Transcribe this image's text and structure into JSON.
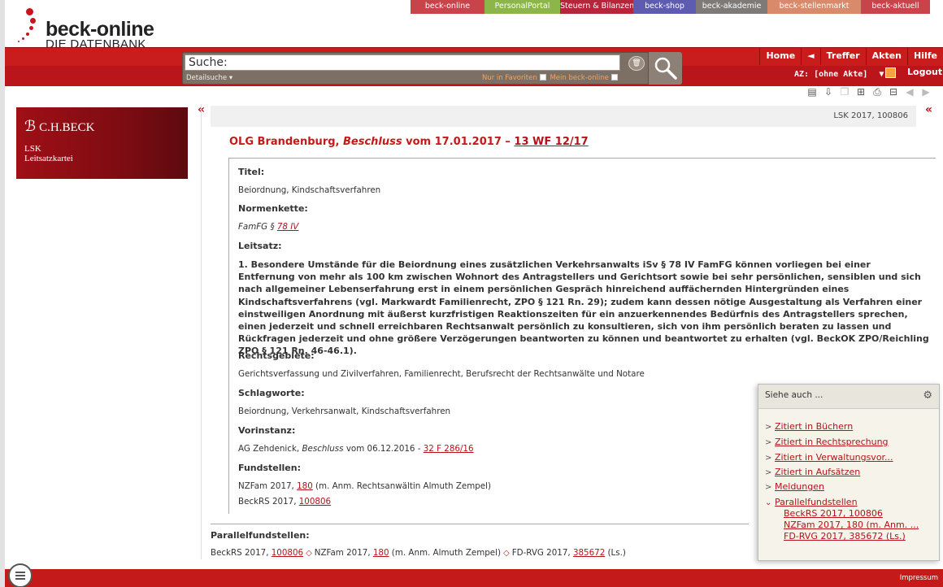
{
  "top_tabs": [
    {
      "label": "beck-online",
      "color": "#c9444a"
    },
    {
      "label": "PersonalPortal",
      "color": "#8db64a"
    },
    {
      "label": "Steuern & Bilanzen",
      "color": "#b5263a"
    },
    {
      "label": "beck-shop",
      "color": "#5e5cb0"
    },
    {
      "label": "beck-akademie",
      "color": "#7d7a78"
    },
    {
      "label": "beck-stellenmarkt",
      "color": "#d88a6a"
    },
    {
      "label": "beck-aktuell",
      "color": "#c9444a"
    }
  ],
  "logo": {
    "name": "beck-online",
    "subtitle": "DIE DATENBANK"
  },
  "search": {
    "placeholder": "Suche:",
    "detail_label": "Detailsuche ▾",
    "favorites_label": "Nur in Favoriten",
    "mybeck_label": "Mein beck-online"
  },
  "nav": {
    "home": "Home",
    "back": "◄",
    "treffer": "Treffer",
    "akten": "Akten",
    "hilfe": "Hilfe",
    "az_label": "AZ: [ohne Akte]",
    "logout": "Logout"
  },
  "left_panel": {
    "brand": "C.H.BECK",
    "seal": "ℬ",
    "title_line1": "LSK",
    "title_line2": "Leitsatzkartei"
  },
  "doc": {
    "reference": "LSK 2017, 100806",
    "court": "OLG Brandenburg, ",
    "type": "Beschluss",
    "date": " vom 17.01.2017 – ",
    "aktenzeichen": "13 WF 12/17",
    "fields": {
      "titel_h": "Titel:",
      "titel_v": "Beiordnung, Kindschaftsverfahren",
      "normenkette_h": "Normenkette:",
      "normenkette_prefix": "FamFG § ",
      "normenkette_link": "78 IV",
      "leitsatz_h": "Leitsatz:",
      "leitsatz": "1. Besondere Umstände für die Beiordnung eines zusätzlichen Verkehrsanwalts iSv § 78 IV FamFG können vorliegen bei einer Entfernung von mehr als 100 km zwischen Wohnort des Antragstellers und Gerichtsort sowie bei sehr persönlichen, sensiblen und sich nach allgemeiner Lebenserfahrung erst in einem persönlichen Gespräch hinreichend auffächernden Hintergründen eines Kindschaftsverfahrens (vgl. Markwardt Familienrecht, ZPO § 121 Rn. 29); zudem kann dessen nötige Ausgestaltung als Verfahren einer einstweiligen Anordnung mit äußerst kurzfristigen Reaktionszeiten für ein anzuerkennendes Bedürfnis des Antragstellers sprechen, einen jederzeit und schnell erreichbaren Rechtsanwalt persönlich zu konsultieren, sich von ihm persönlich beraten zu lassen und Rückfragen jederzeit und ohne größere Verzögerungen beantworten zu können und beantwortet zu erhalten (vgl. BeckOK ZPO/Reichling ZPO § 121 Rn. 46-46.1).",
      "rechtsgebiete_h": "Rechtsgebiete:",
      "rechtsgebiete_v": "Gerichtsverfassung und Zivilverfahren, Familienrecht, Berufsrecht der Rechtsanwälte und Notare",
      "schlagworte_h": "Schlagworte:",
      "schlagworte_v": "Beiordnung, Verkehrsanwalt, Kindschaftsverfahren",
      "vorinstanz_h": "Vorinstanz:",
      "vorinstanz_prefix": "AG Zehdenick, ",
      "vorinstanz_type": "Beschluss",
      "vorinstanz_mid": " vom 06.12.2016 - ",
      "vorinstanz_link": "32 F 286/16",
      "fundstellen_h": "Fundstellen:",
      "fund1_prefix": "NZFam 2017, ",
      "fund1_link": "180",
      "fund1_suffix": " (m. Anm. Rechtsanwältin Almuth Zempel)",
      "fund2_prefix": "BeckRS 2017, ",
      "fund2_link": "100806"
    },
    "parallel": {
      "heading": "Parallelfundstellen:",
      "p1_prefix": "BeckRS 2017, ",
      "p1_link": "100806",
      "p2_prefix": "NZFam 2017, ",
      "p2_link": "180",
      "p2_suffix": " (m. Anm. Almuth Zempel)",
      "p3_prefix": "FD-RVG 2017, ",
      "p3_link": "385672",
      "p3_suffix": " (Ls.)"
    }
  },
  "siehe_auch": {
    "title": "Siehe auch ...",
    "items": [
      "Zitiert in Büchern",
      "Zitiert in Rechtsprechung",
      "Zitiert in Verwaltungsvor...",
      "Zitiert in Aufsätzen",
      "Meldungen",
      "Parallelfundstellen"
    ],
    "sub_items": [
      "BeckRS 2017, 100806",
      "NZFam 2017, 180 (m. Anm. ...",
      "FD-RVG 2017, 385672 (Ls.)"
    ]
  },
  "footer": {
    "impressum": "Impressum"
  },
  "colors": {
    "brand_red": "#c41a1a",
    "link_red": "#b5131a"
  }
}
